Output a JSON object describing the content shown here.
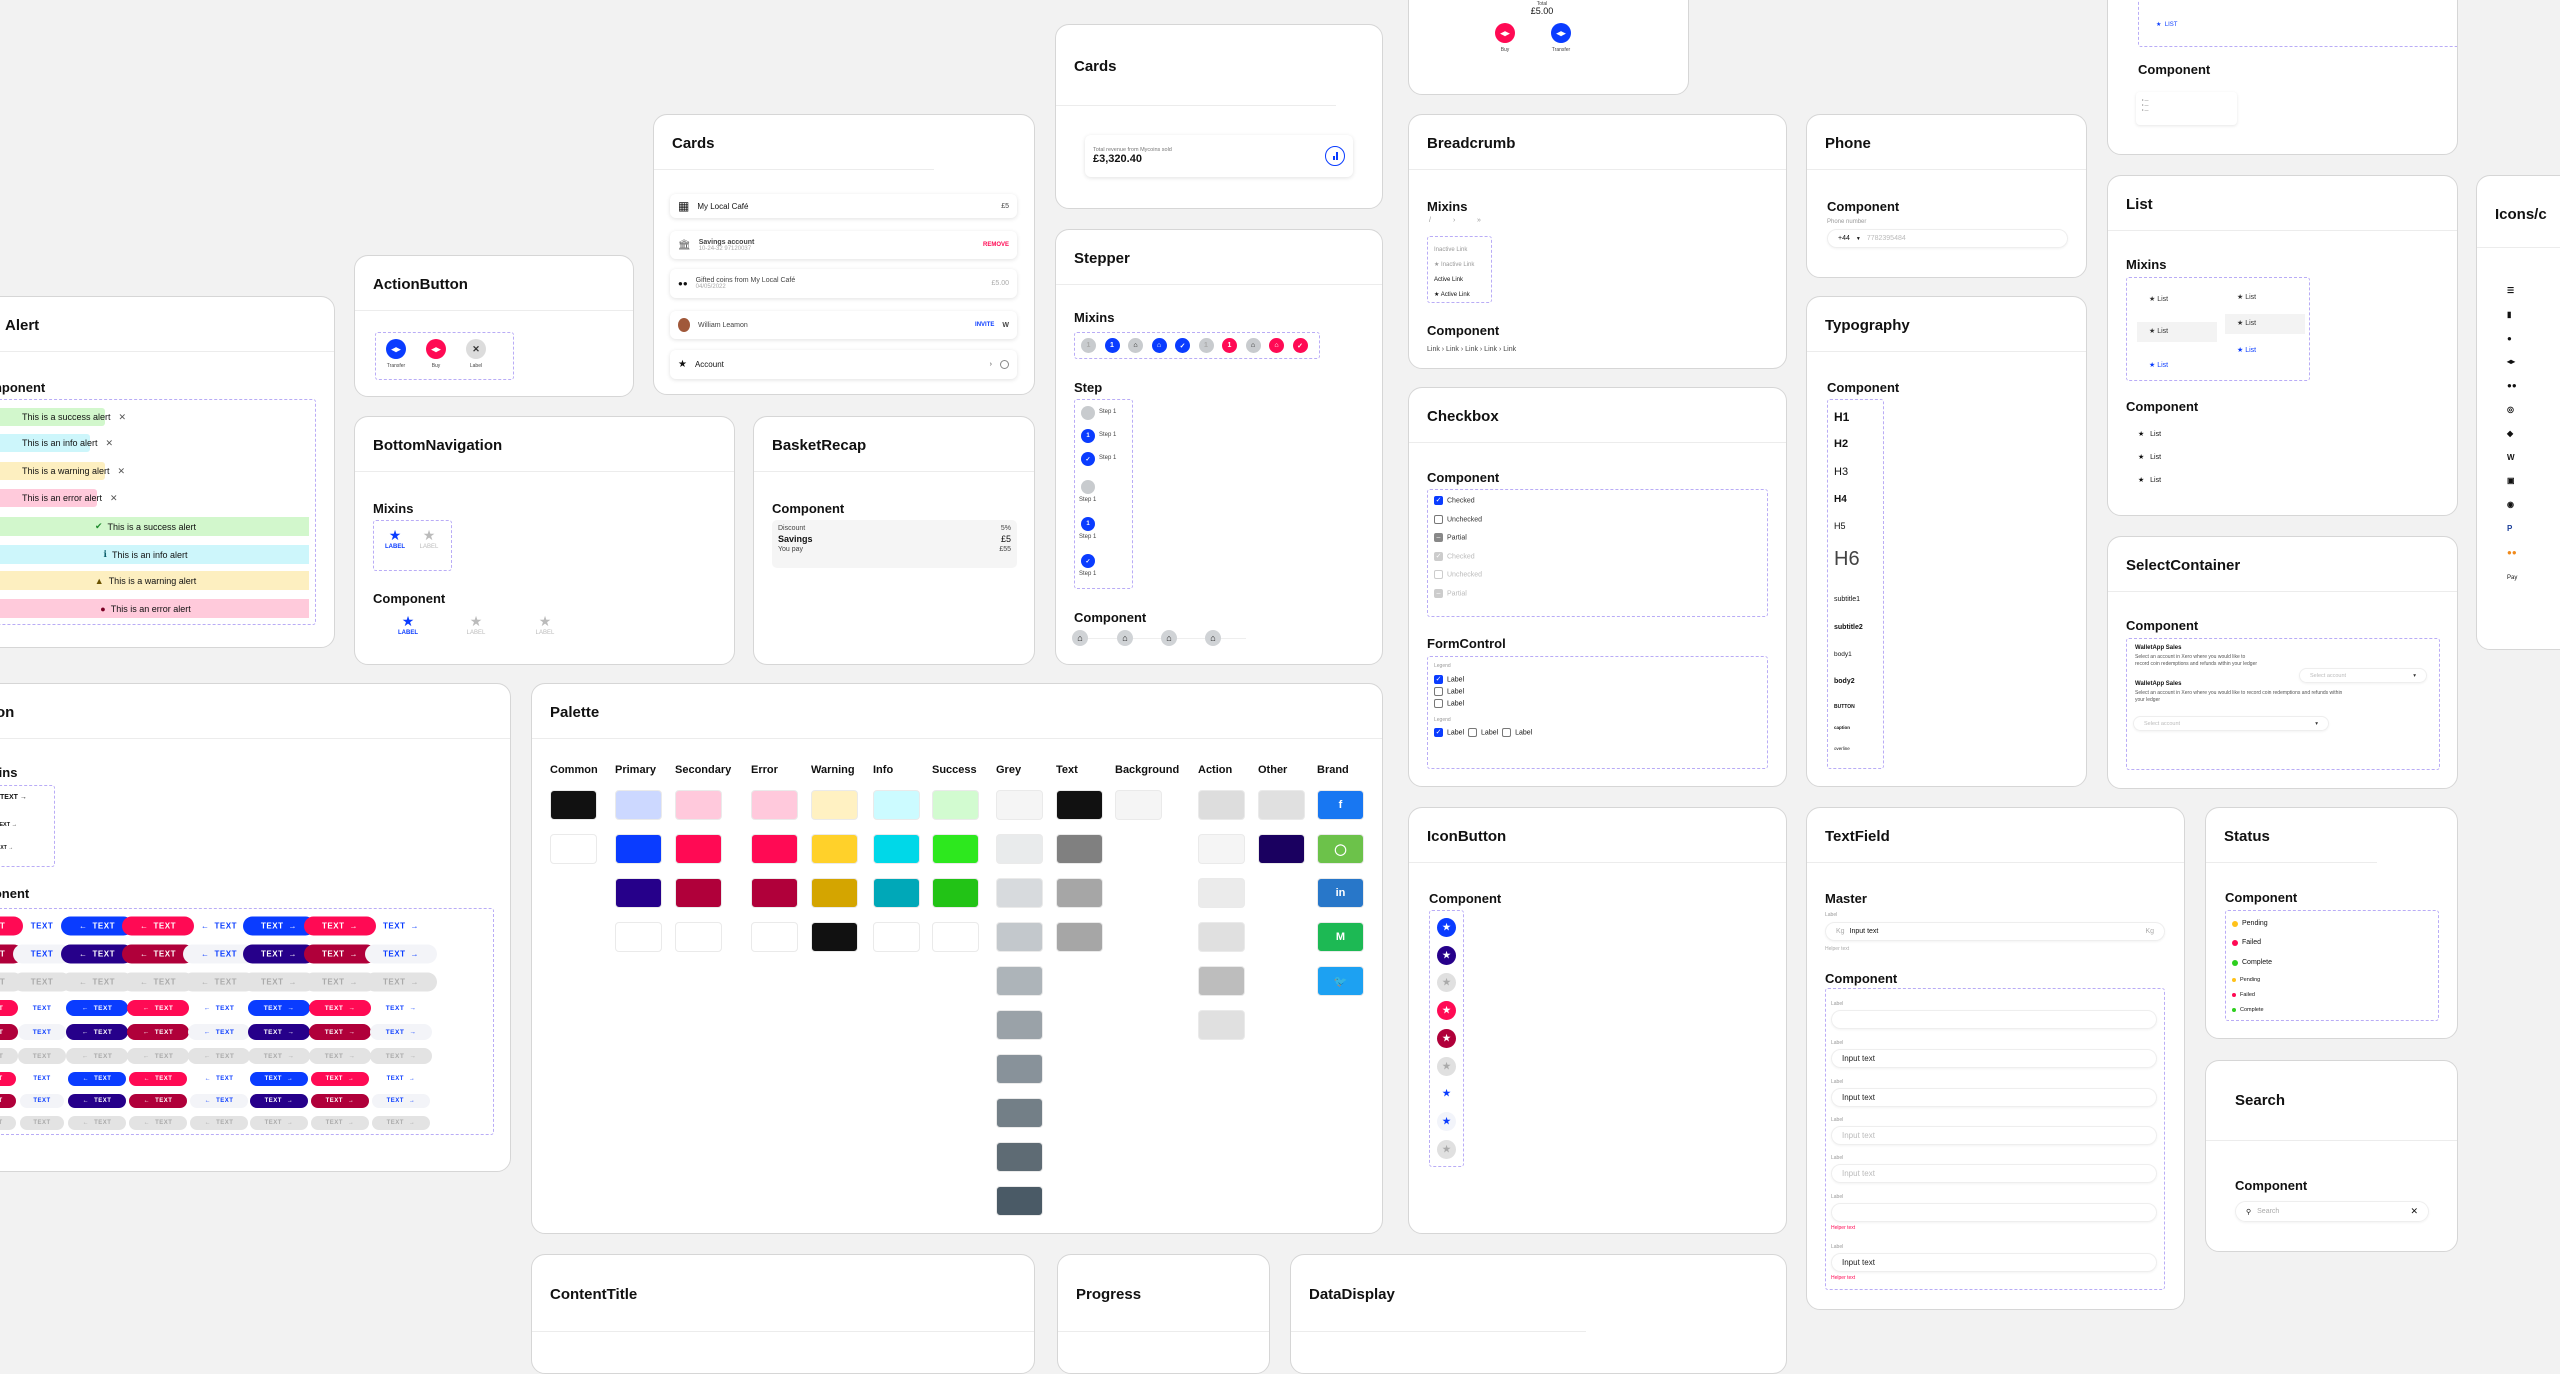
{
  "colors": {
    "primary": "#0a3cff",
    "primary_dark": "#26008a",
    "secondary": "#ff0a54",
    "secondary_dark": "#b0003a",
    "grey": "#e0e0e0",
    "dash": "#b9acf6"
  },
  "alert": {
    "title": "Alert",
    "section": "Component",
    "chips": [
      {
        "text": "This is a success alert",
        "bg": "#d2f7cc"
      },
      {
        "text": "This is an info alert",
        "bg": "#cdf6fb"
      },
      {
        "text": "This is a warning alert",
        "bg": "#fdefc0"
      },
      {
        "text": "This is an error alert",
        "bg": "#ffcadb"
      }
    ],
    "bars": [
      {
        "text": "This is a success alert",
        "bg": "#d2f7cc",
        "icon": "check-circle",
        "icon_color": "#1d8a2c"
      },
      {
        "text": "This is an info alert",
        "bg": "#cdf6fb",
        "icon": "info-circle",
        "icon_color": "#0b5f6c"
      },
      {
        "text": "This is a warning alert",
        "bg": "#fdefc0",
        "icon": "warning-triangle",
        "icon_color": "#6b5200"
      },
      {
        "text": "This is an error alert",
        "bg": "#ffcadb",
        "icon": "error-circle",
        "icon_color": "#7a0025"
      }
    ]
  },
  "action_button": {
    "title": "ActionButton",
    "items": [
      {
        "label": "Transfer",
        "color": "#0a3cff",
        "icon": "transfer"
      },
      {
        "label": "Buy",
        "color": "#ff0a54",
        "icon": "buy"
      },
      {
        "label": "Label",
        "color": "#dcdcdc",
        "icon": "close"
      }
    ]
  },
  "bottom_navigation": {
    "title": "BottomNavigation",
    "mixins": "Mixins",
    "component": "Component",
    "item_label": "LABEL"
  },
  "basket_recap": {
    "title": "BasketRecap",
    "section": "Component",
    "discount_label": "Discount",
    "discount_value": "5%",
    "savings_label": "Savings",
    "savings_value": "£5",
    "pay_label": "You pay",
    "pay_value": "£55"
  },
  "cards_list": {
    "title": "Cards",
    "rows": [
      {
        "icon": "checker",
        "title": "My Local Café",
        "value": "£5"
      },
      {
        "icon": "bank",
        "title": "Savings account",
        "sub": "10-24-32  97120037",
        "action": "REMOVE"
      },
      {
        "icon": "coins",
        "title": "Gifted coins from My Local Café",
        "sub": "04/05/2022",
        "value": "£5.00"
      },
      {
        "icon": "avatar",
        "title": "William Leamon",
        "action": "INVITE"
      },
      {
        "icon": "star",
        "title": "Account"
      }
    ]
  },
  "cards_revenue": {
    "title": "Cards",
    "caption": "Total revenue from Mycoins sold",
    "amount": "£3,320.40"
  },
  "top_card": {
    "total_label": "Total",
    "total_value": "£5.00",
    "buy": "Buy",
    "transfer": "Transfer"
  },
  "stepper": {
    "title": "Stepper",
    "mixins": "Mixins",
    "step": "Step",
    "component": "Component",
    "step_label": "Step 1",
    "mixin_items": [
      {
        "c": "#c8cbce",
        "g": "1"
      },
      {
        "c": "#0a3cff",
        "g": "1"
      },
      {
        "c": "#c8cbce",
        "g": "basket"
      },
      {
        "c": "#0a3cff",
        "g": "basket"
      },
      {
        "c": "#0a3cff",
        "g": "check"
      },
      {
        "c": "#c8cbce",
        "g": "1"
      },
      {
        "c": "#ff0a54",
        "g": "1"
      },
      {
        "c": "#c8cbce",
        "g": "basket"
      },
      {
        "c": "#ff0a54",
        "g": "basket"
      },
      {
        "c": "#ff0a54",
        "g": "check"
      }
    ]
  },
  "breadcrumb": {
    "title": "Breadcrumb",
    "mixins": "Mixins",
    "separators": [
      "/",
      "›",
      "»"
    ],
    "links": [
      "Inactive Link",
      "Inactive Link",
      "Active Link",
      "Active Link"
    ],
    "component": "Component",
    "trail": "Link › Link › Link › Link › Link"
  },
  "phone": {
    "title": "Phone",
    "section": "Component",
    "label": "Phone number",
    "code": "+44",
    "placeholder": "7782395484"
  },
  "typography": {
    "title": "Typography",
    "section": "Component",
    "items": [
      "H1",
      "H2",
      "H3",
      "H4",
      "H5",
      "H6",
      "subtitle1",
      "subtitle2",
      "body1",
      "body2",
      "BUTTON",
      "caption",
      "overline"
    ]
  },
  "checkbox": {
    "title": "Checkbox",
    "section": "Component",
    "items": [
      {
        "label": "Checked",
        "state": "checked"
      },
      {
        "label": "Unchecked",
        "state": "unchecked"
      },
      {
        "label": "Partial",
        "state": "partial"
      },
      {
        "label": "Checked",
        "state": "checked-disabled"
      },
      {
        "label": "Unchecked",
        "state": "unchecked-disabled"
      },
      {
        "label": "Partial",
        "state": "partial-disabled"
      }
    ],
    "formcontrol": "FormControl",
    "legend": "Legend",
    "label": "Label"
  },
  "list_top": {
    "item": "LIST",
    "section": "Component"
  },
  "list": {
    "title": "List",
    "mixins": "Mixins",
    "component": "Component",
    "item": "List"
  },
  "select_container": {
    "title": "SelectContainer",
    "section": "Component",
    "heading": "WalletApp Sales",
    "description": "Select an account in Xero where you would like to record coin redemptions and refunds within your ledger",
    "placeholder": "Select account"
  },
  "icons": {
    "title": "Icons/c",
    "items": [
      "list-plus-icon",
      "bar-chart-icon",
      "user-icon",
      "transfer-icon",
      "buy-icon",
      "coins-icon",
      "tag-icon",
      "w-logo-icon",
      "wallet-icon",
      "user-search-icon",
      "paypal-icon",
      "mastercard-icon",
      "apple-pay-icon"
    ],
    "apple_pay": "Pay"
  },
  "button": {
    "title": "Button",
    "mixins": "Mixins",
    "component": "Component",
    "label": "TEXT",
    "columns": [
      {
        "variant": "contained",
        "color": "primary",
        "icon": ""
      },
      {
        "variant": "contained",
        "color": "secondary",
        "icon": ""
      },
      {
        "variant": "text",
        "color": "primary",
        "icon": ""
      },
      {
        "variant": "contained",
        "color": "primary",
        "icon": "start"
      },
      {
        "variant": "contained",
        "color": "secondary",
        "icon": "start"
      },
      {
        "variant": "text",
        "color": "primary",
        "icon": "start"
      },
      {
        "variant": "contained",
        "color": "primary",
        "icon": "end"
      },
      {
        "variant": "contained",
        "color": "secondary",
        "icon": "end"
      },
      {
        "variant": "text",
        "color": "primary",
        "icon": "end"
      }
    ],
    "rows": [
      {
        "size": "large",
        "tone": "main"
      },
      {
        "size": "large",
        "tone": "dark"
      },
      {
        "size": "large",
        "tone": "disabled"
      },
      {
        "size": "medium",
        "tone": "main"
      },
      {
        "size": "medium",
        "tone": "dark"
      },
      {
        "size": "medium",
        "tone": "disabled"
      },
      {
        "size": "small",
        "tone": "main"
      },
      {
        "size": "small",
        "tone": "dark"
      },
      {
        "size": "small",
        "tone": "disabled"
      }
    ]
  },
  "palette": {
    "title": "Palette",
    "columns": [
      {
        "name": "Common",
        "swatches": [
          "#111111",
          "#ffffff"
        ]
      },
      {
        "name": "Primary",
        "swatches": [
          "#ccd8ff",
          "#0a3cff",
          "#26008a",
          "#ffffff"
        ]
      },
      {
        "name": "Secondary",
        "swatches": [
          "#ffc9dc",
          "#ff0a54",
          "#b0003a",
          "#ffffff"
        ]
      },
      {
        "name": "Error",
        "swatches": [
          "#ffc9dc",
          "#ff0a54",
          "#b0003a",
          "#ffffff"
        ]
      },
      {
        "name": "Warning",
        "swatches": [
          "#fff1c2",
          "#ffd12a",
          "#d4a500",
          "#111111"
        ]
      },
      {
        "name": "Info",
        "swatches": [
          "#ccfbff",
          "#00d8e8",
          "#00a8b8",
          "#ffffff"
        ]
      },
      {
        "name": "Success",
        "swatches": [
          "#d2fbd0",
          "#2de81e",
          "#22c316",
          "#ffffff"
        ]
      },
      {
        "name": "Grey",
        "swatches": [
          "#f5f5f5",
          "#e9ebec",
          "#d7dadd",
          "#c3c8cc",
          "#adb4b9",
          "#9aa2a8",
          "#88929a",
          "#737f87",
          "#5e6b74",
          "#4a5a66"
        ]
      },
      {
        "name": "Text",
        "swatches": [
          "#111111",
          "#808080",
          "#a6a6a6",
          "#a6a6a6"
        ]
      },
      {
        "name": "Background",
        "swatches": [
          "#f5f5f5"
        ]
      },
      {
        "name": "Action",
        "swatches": [
          "#dddddd",
          "#f5f5f5",
          "#ebebeb",
          "#e0e0e0",
          "#bdbdbd",
          "#e0e0e0"
        ]
      },
      {
        "name": "Other",
        "swatches": [
          "#e0e0e0",
          "#1a0060"
        ]
      },
      {
        "name": "Brand",
        "swatches": [
          "#1877f2",
          "#6cc24a",
          "#2877c9",
          "#1db954",
          "#1da1f2"
        ],
        "glyphs": [
          "f",
          "◯",
          "in",
          "M",
          "🐦"
        ]
      }
    ]
  },
  "icon_button": {
    "title": "IconButton",
    "section": "Component",
    "items": [
      {
        "bg": "#0a3cff",
        "fg": "#fff"
      },
      {
        "bg": "#26008a",
        "fg": "#fff"
      },
      {
        "bg": "#e0e0e0",
        "fg": "#aaa"
      },
      {
        "bg": "#ff0a54",
        "fg": "#fff"
      },
      {
        "bg": "#b0003a",
        "fg": "#fff"
      },
      {
        "bg": "#e0e0e0",
        "fg": "#aaa"
      },
      {
        "bg": "transparent",
        "fg": "#0a3cff"
      },
      {
        "bg": "#f2f4fa",
        "fg": "#0a3cff"
      },
      {
        "bg": "#e0e0e0",
        "fg": "#aaa"
      }
    ]
  },
  "textfield": {
    "title": "TextField",
    "master": "Master",
    "component": "Component",
    "label": "Label",
    "input": "Input text",
    "unit": "Kg",
    "helper": "Helper text",
    "fields": [
      {
        "value": "",
        "state": "empty"
      },
      {
        "value": "Input text",
        "state": "filled"
      },
      {
        "value": "Input text",
        "state": "filled"
      },
      {
        "value": "Input text",
        "state": "placeholder"
      },
      {
        "value": "Input text",
        "state": "placeholder"
      },
      {
        "value": "",
        "state": "error",
        "helper": "Helper text"
      },
      {
        "value": "Input text",
        "state": "error",
        "helper": "Helper text"
      }
    ]
  },
  "status": {
    "title": "Status",
    "section": "Component",
    "items": [
      {
        "label": "Pending",
        "color": "#ffc21a",
        "size": "large"
      },
      {
        "label": "Failed",
        "color": "#ff0a54",
        "size": "large"
      },
      {
        "label": "Complete",
        "color": "#2dcf1e",
        "size": "large"
      },
      {
        "label": "Pending",
        "color": "#ffc21a",
        "size": "small"
      },
      {
        "label": "Failed",
        "color": "#ff0a54",
        "size": "small"
      },
      {
        "label": "Complete",
        "color": "#2dcf1e",
        "size": "small"
      }
    ]
  },
  "search": {
    "title": "Search",
    "section": "Component",
    "placeholder": "Search"
  },
  "content_title": {
    "title": "ContentTitle"
  },
  "progress": {
    "title": "Progress"
  },
  "data_display": {
    "title": "DataDisplay"
  }
}
